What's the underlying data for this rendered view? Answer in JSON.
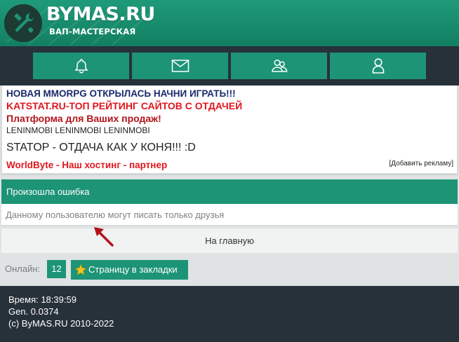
{
  "header": {
    "site_title": "BYMAS.RU",
    "site_subtitle": "ВАП-МАСТЕРСКАЯ",
    "logo_icon": "wrench-screwdriver-icon"
  },
  "nav": [
    {
      "icon": "bell-icon"
    },
    {
      "icon": "mail-icon"
    },
    {
      "icon": "friends-icon"
    },
    {
      "icon": "user-icon"
    }
  ],
  "ads": {
    "items": [
      "НОВАЯ MMORPG ОТКРЫЛАСЬ НАЧНИ ИГРАТЬ!!!",
      "KATSTAT.RU-ТОП РЕЙТИНГ САЙТОВ С ОТДАЧЕЙ",
      "Платформа для Ваших продаж!",
      "LENINMOBI LENINMOBI LENINMOBI",
      "STATOP - ОТДАЧА КАК У КОНЯ!!! :D",
      "WorldByte - Наш хостинг - партнер"
    ],
    "add_link": "[Добавить рекламу]"
  },
  "error": {
    "title": "Произошла ошибка",
    "message": "Данному пользователю могут писать только друзья"
  },
  "home_link": "На главную",
  "online": {
    "label": "Онлайн:",
    "count": "12"
  },
  "bookmark": {
    "label": "Страницу в закладки",
    "icon": "star-icon"
  },
  "footer": {
    "time": "Время: 18:39:59",
    "gen": "Gen. 0.0374",
    "copyright": "(c) ByMAS.RU 2010-2022"
  },
  "colors": {
    "brand_green": "#1d9476",
    "dark_bar": "#27313a",
    "ad_red": "#e0161d",
    "ad_navy": "#1b2a6b",
    "arrow": "#b3131a",
    "star": "#f2c21b"
  }
}
